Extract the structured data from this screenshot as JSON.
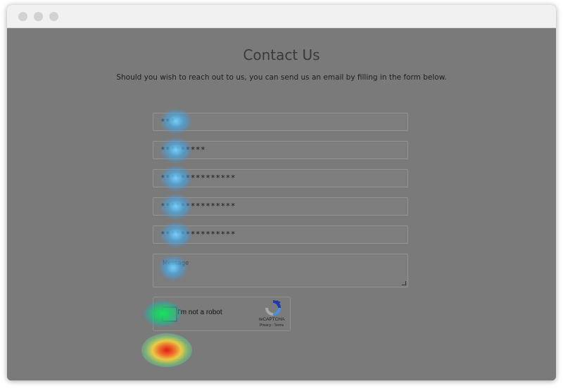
{
  "page": {
    "title": "Contact Us",
    "subtitle": "Should you wish to reach out to us, you can send us an email by filling in the form below."
  },
  "form": {
    "fields": [
      {
        "value": "***"
      },
      {
        "value": "*********"
      },
      {
        "value": "***************"
      },
      {
        "value": "***************"
      },
      {
        "value": "***************"
      }
    ],
    "message_placeholder": "Message",
    "captcha": {
      "label": "I'm not a robot",
      "brand": "reCAPTCHA",
      "links": "Privacy - Terms"
    },
    "submit_label": ""
  },
  "colors": {
    "overlay": "#7a7a7b",
    "heat_cold": "#4fb6ea",
    "heat_warm": "#1fd46a",
    "heat_hot": "#e0281c"
  }
}
